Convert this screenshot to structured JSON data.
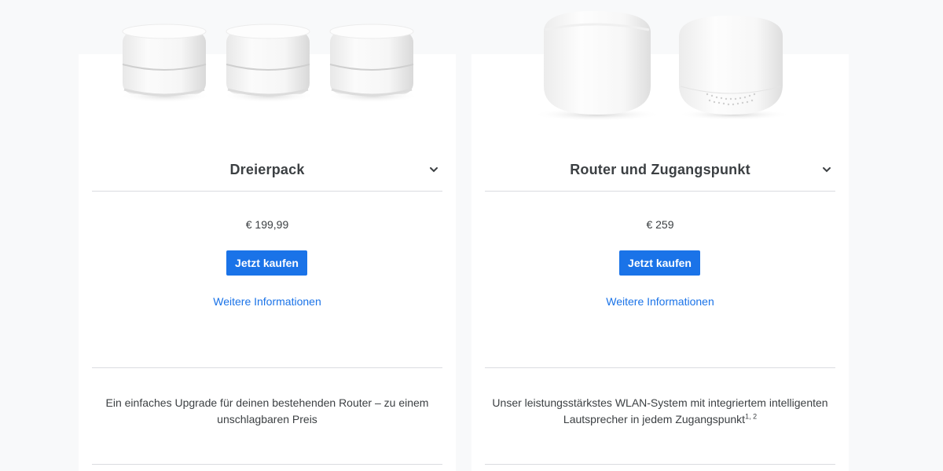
{
  "products": [
    {
      "image_alt": "Google Wifi Dreierpack",
      "variant_label": "Dreierpack",
      "price": "€ 199,99",
      "buy_label": "Jetzt kaufen",
      "more_info_label": "Weitere Informationen",
      "description": "Ein einfaches Upgrade für deinen bestehenden Router – zu einem unschlagbaren Preis",
      "footnote": ""
    },
    {
      "image_alt": "Nest Wifi Router und Zugangspunkt",
      "variant_label": "Router und Zugangspunkt",
      "price": "€ 259",
      "buy_label": "Jetzt kaufen",
      "more_info_label": "Weitere Informationen",
      "description": "Unser leistungsstärkstes WLAN-System mit integriertem intelligenten Lautsprecher in jedem Zugangspunkt",
      "footnote": "1, 2"
    }
  ],
  "icons": {
    "variant_dropdown": "chevron-down-icon"
  },
  "colors": {
    "accent": "#1a73e8",
    "text": "#3c4043",
    "divider": "#dadce0",
    "background": "#f8f9fa"
  }
}
